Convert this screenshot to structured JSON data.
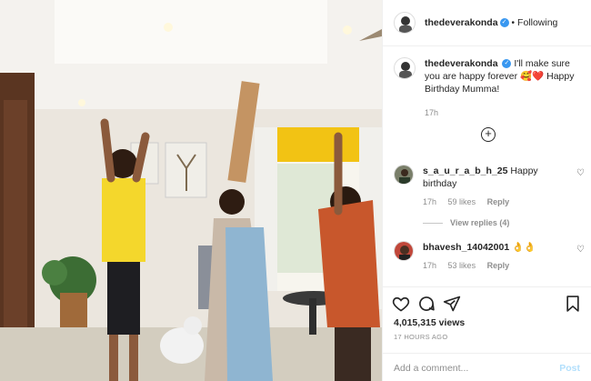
{
  "post": {
    "author": "thedeverakonda",
    "follow_separator": "•",
    "follow_status": "Following",
    "caption_author": "thedeverakonda",
    "caption_text": "I'll make sure you are happy forever 🥰❤️ Happy Birthday Mumma!",
    "caption_time": "17h",
    "verified_mark": "✓"
  },
  "load_more_icon": "plus-circle-icon",
  "comments": [
    {
      "author": "s_a_u_r_a_b_h_25",
      "text": "Happy birthday",
      "time": "17h",
      "likes": "59 likes",
      "reply": "Reply",
      "view_replies": "View replies (4)"
    },
    {
      "author": "bhavesh_14042001",
      "text": "👌👌",
      "time": "17h",
      "likes": "53 likes",
      "reply": "Reply"
    }
  ],
  "actions": {
    "views": "4,015,315 views",
    "time_ago": "17 HOURS AGO",
    "comment_placeholder": "Add a comment...",
    "post_label": "Post"
  },
  "icons": [
    "heart-icon",
    "comment-icon",
    "share-icon",
    "bookmark-icon",
    "more-options-icon"
  ],
  "colors": {
    "accent": "#3897f0",
    "post_disabled": "#b2dffc",
    "muted": "#8e8e8e",
    "shirt_yellow": "#f4d72c"
  }
}
